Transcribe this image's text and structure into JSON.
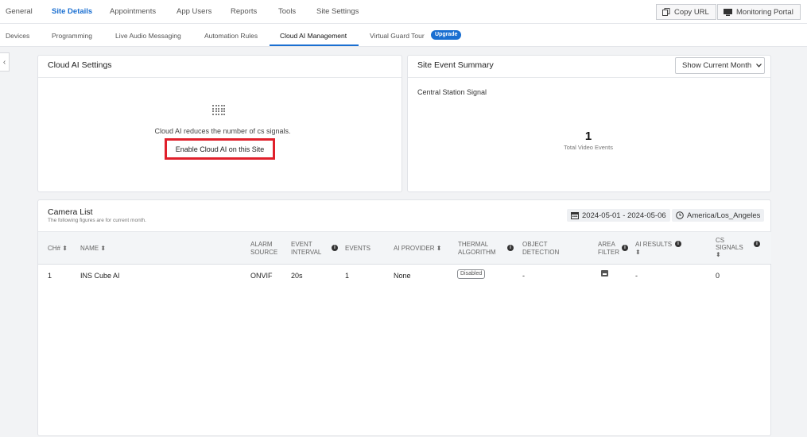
{
  "top_nav": {
    "tabs": [
      "General",
      "Site Details",
      "Appointments",
      "App Users",
      "Reports",
      "Tools",
      "Site Settings"
    ],
    "copy_url": "Copy URL",
    "monitoring_portal": "Monitoring Portal"
  },
  "sub_nav": {
    "tabs": [
      "Devices",
      "Programming",
      "Live Audio Messaging",
      "Automation Rules",
      "Cloud AI Management",
      "Virtual Guard Tour"
    ],
    "upgrade_badge": "Upgrade"
  },
  "cloud_ai": {
    "title": "Cloud AI Settings",
    "description": "Cloud AI reduces the number of cs signals.",
    "enable_label": "Enable Cloud AI on this Site"
  },
  "event_summary": {
    "title": "Site Event Summary",
    "period": "Show Current Month",
    "signal_label": "Central Station Signal",
    "total_value": "1",
    "total_label": "Total Video Events"
  },
  "camera_list": {
    "title": "Camera List",
    "subtitle": "The following figures are for current month.",
    "date_range": "2024-05-01 - 2024-05-06",
    "timezone": "America/Los_Angeles",
    "columns": {
      "ch": "CH# ⬍",
      "name": "NAME ⬍",
      "alarm_1": "ALARM",
      "alarm_2": "SOURCE",
      "interval_1": "EVENT",
      "interval_2": "INTERVAL",
      "events": "EVENTS",
      "provider": "AI PROVIDER ⬍",
      "thermal_1": "THERMAL",
      "thermal_2": "ALGORITHM",
      "object_1": "OBJECT",
      "object_2": "DETECTION",
      "area_1": "AREA",
      "area_2": "FILTER",
      "results_1": "AI RESULTS",
      "results_2": "⬍",
      "signals_1": "CS",
      "signals_2": "SIGNALS",
      "signals_3": "⬍"
    },
    "rows": [
      {
        "ch": "1",
        "name": "INS Cube AI",
        "alarm_source": "ONVIF",
        "event_interval": "20s",
        "events": "1",
        "ai_provider": "None",
        "thermal": "Disabled",
        "object_detection": "-",
        "ai_results": "-",
        "cs_signals": "0"
      }
    ]
  },
  "colors": {
    "accent": "#1a6fd1",
    "highlight_box": "#e0202b"
  }
}
